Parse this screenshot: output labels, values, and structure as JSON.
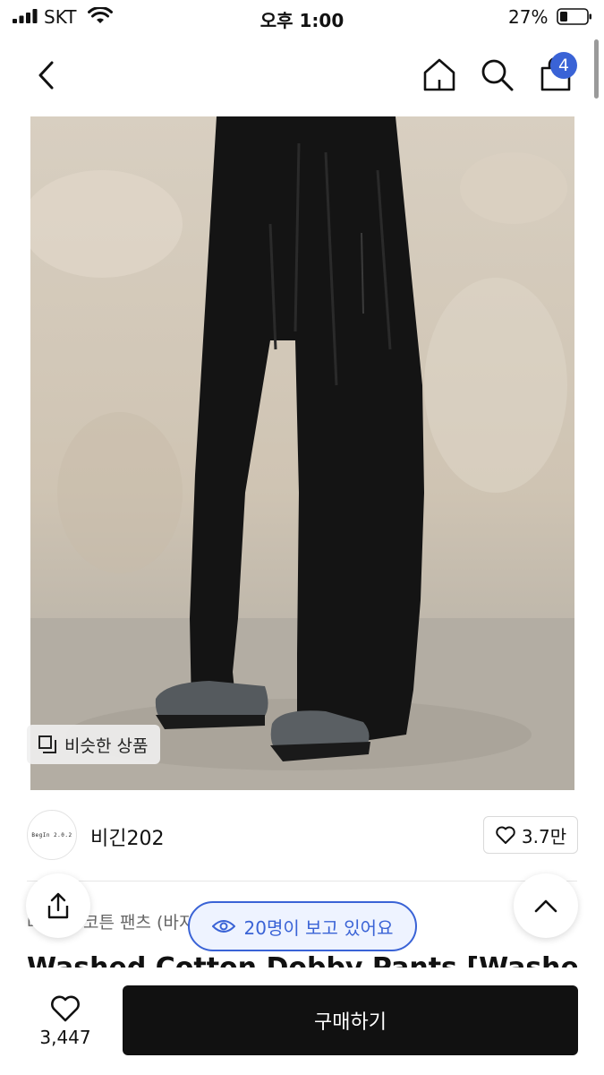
{
  "status_bar": {
    "carrier": "SKT",
    "time": "오후 1:00",
    "battery": "27%",
    "icons": [
      "signal-icon",
      "wifi-icon",
      "battery-icon"
    ]
  },
  "nav": {
    "icons": [
      "back-icon",
      "home-icon",
      "search-icon",
      "bag-icon"
    ],
    "cart_badge": "4"
  },
  "product": {
    "similar_label": "비슷한 상품",
    "category": "바지 > 코튼 팬츠 (바지)",
    "title": "Washed Cotton Dobby Pants [Washed Bla"
  },
  "seller": {
    "logo_text": "BegIn 2.0.2",
    "name": "비긴202",
    "likes": "3.7만"
  },
  "viewers": {
    "label": "20명이 보고 있어요"
  },
  "bottom": {
    "wish_count": "3,447",
    "buy_label": "구매하기"
  },
  "colors": {
    "accent": "#3a63d6",
    "buy_button": "#111111"
  }
}
